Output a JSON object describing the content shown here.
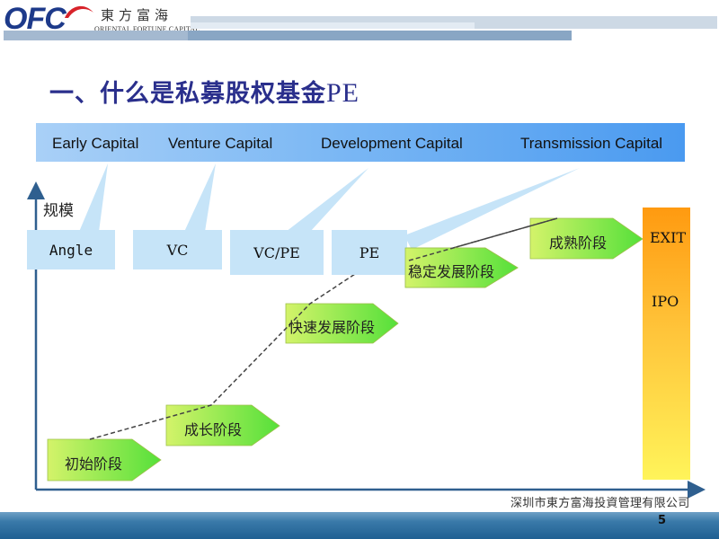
{
  "header": {
    "logo_mark": "OFC",
    "logo_cn": "東方富海",
    "logo_en": "ORIENTAL FORTUNE CAPITAL"
  },
  "title": {
    "main": "一、什么是私募股权基金",
    "suffix": "PE"
  },
  "capital_band": {
    "labels": [
      "Early Capital",
      "Venture Capital",
      "Development Capital",
      "Transmission Capital"
    ]
  },
  "investor_types": [
    "Angle",
    "VC",
    "VC/PE",
    "PE"
  ],
  "axis": {
    "y_label": "规模"
  },
  "phases": [
    "初始阶段",
    "成长阶段",
    "快速发展阶段",
    "稳定发展阶段",
    "成熟阶段"
  ],
  "exit": {
    "labels": [
      "EXIT",
      "IPO"
    ]
  },
  "colors": {
    "title": "#2a2f8c",
    "band_start": "#a9d0f7",
    "band_end": "#4a9af0",
    "stage_box": "#c6e4f8",
    "phase_start": "#d4f36a",
    "phase_end": "#55e03a",
    "exit_top": "#ff9a10",
    "exit_bottom": "#fff45a",
    "axis": "#2f5f8f"
  },
  "footer": {
    "company": "深圳市東方富海投資管理有限公司",
    "page_number": "5"
  }
}
